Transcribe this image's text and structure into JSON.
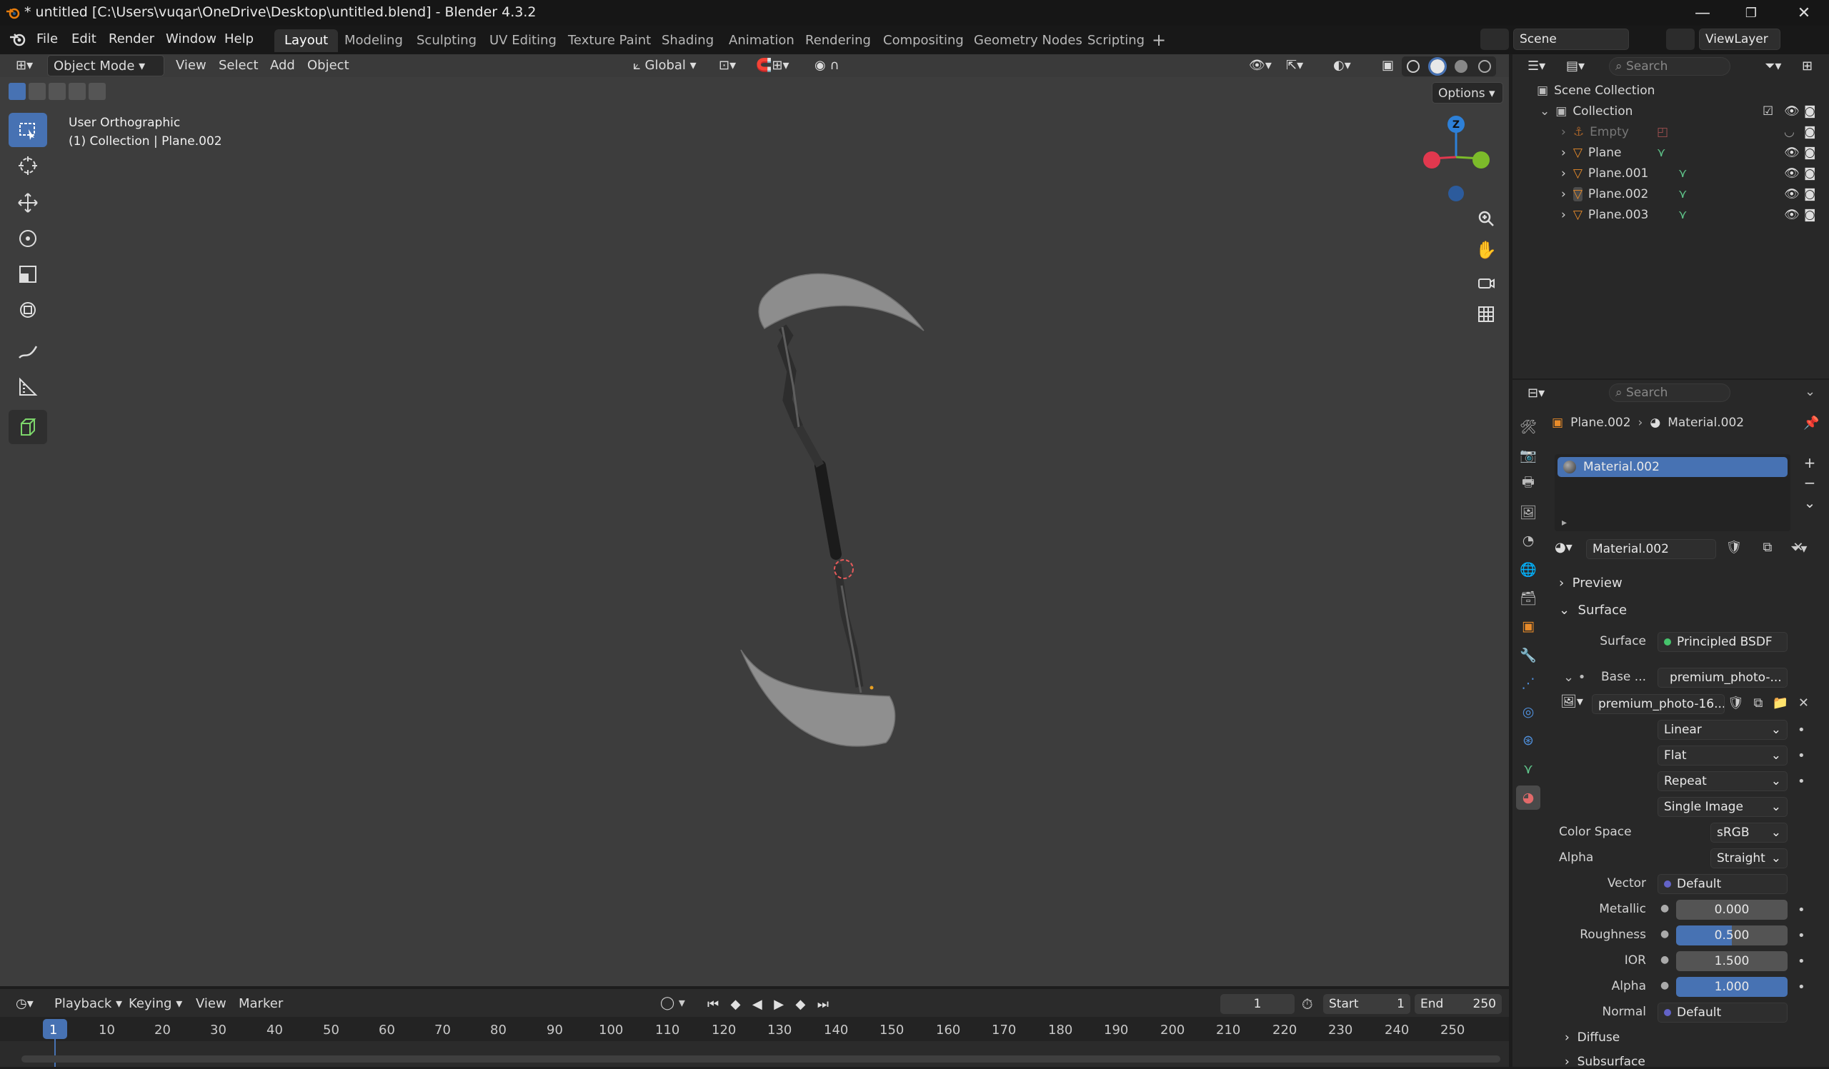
{
  "titlebar": {
    "title": "* untitled [C:\\Users\\vuqar\\OneDrive\\Desktop\\untitled.blend] - Blender 4.3.2"
  },
  "menu": {
    "file": "File",
    "edit": "Edit",
    "render": "Render",
    "window": "Window",
    "help": "Help"
  },
  "workspaces": [
    "Layout",
    "Modeling",
    "Sculpting",
    "UV Editing",
    "Texture Paint",
    "Shading",
    "Animation",
    "Rendering",
    "Compositing",
    "Geometry Nodes",
    "Scripting"
  ],
  "scene": {
    "scene_name": "Scene",
    "view_layer": "ViewLayer"
  },
  "viewport": {
    "mode": "Object Mode",
    "view": "View",
    "select": "Select",
    "add": "Add",
    "object": "Object",
    "orientation": "Global",
    "options": "Options",
    "overlay_line1": "User Orthographic",
    "overlay_line2": "(1) Collection | Plane.002",
    "gizmo_z": "Z"
  },
  "timeline": {
    "playback": "Playback",
    "keying": "Keying",
    "view": "View",
    "marker": "Marker",
    "current_frame": "1",
    "start_label": "Start",
    "start": "1",
    "end_label": "End",
    "end": "250",
    "ruler": [
      "1",
      "10",
      "20",
      "30",
      "40",
      "50",
      "60",
      "70",
      "80",
      "90",
      "100",
      "110",
      "120",
      "130",
      "140",
      "150",
      "160",
      "170",
      "180",
      "190",
      "200",
      "210",
      "220",
      "230",
      "240",
      "250"
    ]
  },
  "outliner": {
    "search_placeholder": "Search",
    "scene_collection": "Scene Collection",
    "collection": "Collection",
    "items": [
      "Empty",
      "Plane",
      "Plane.001",
      "Plane.002",
      "Plane.003"
    ]
  },
  "properties": {
    "search_placeholder": "Search",
    "breadcrumb_object": "Plane.002",
    "breadcrumb_material": "Material.002",
    "slot": "Material.002",
    "material_name": "Material.002",
    "preview": "Preview",
    "surface_section": "Surface",
    "surface_label": "Surface",
    "surface_value": "Principled BSDF",
    "base_label": "Base ...",
    "base_value": "premium_photo-...",
    "image_name": "premium_photo-16...",
    "interpolation": "Linear",
    "projection": "Flat",
    "extension": "Repeat",
    "source": "Single Image",
    "color_space_label": "Color Space",
    "color_space": "sRGB",
    "alpha_mode_label": "Alpha",
    "alpha_mode": "Straight",
    "vector_label": "Vector",
    "vector": "Default",
    "metallic_label": "Metallic",
    "metallic": "0.000",
    "roughness_label": "Roughness",
    "roughness": "0.500",
    "ior_label": "IOR",
    "ior": "1.500",
    "alpha_label": "Alpha",
    "alpha": "1.000",
    "normal_label": "Normal",
    "normal": "Default",
    "diffuse": "Diffuse",
    "subsurface": "Subsurface"
  },
  "colors": {
    "accent": "#4772b3",
    "x_axis": "#e1384e",
    "y_axis": "#7cbb2a",
    "z_axis": "#2d80d8"
  }
}
